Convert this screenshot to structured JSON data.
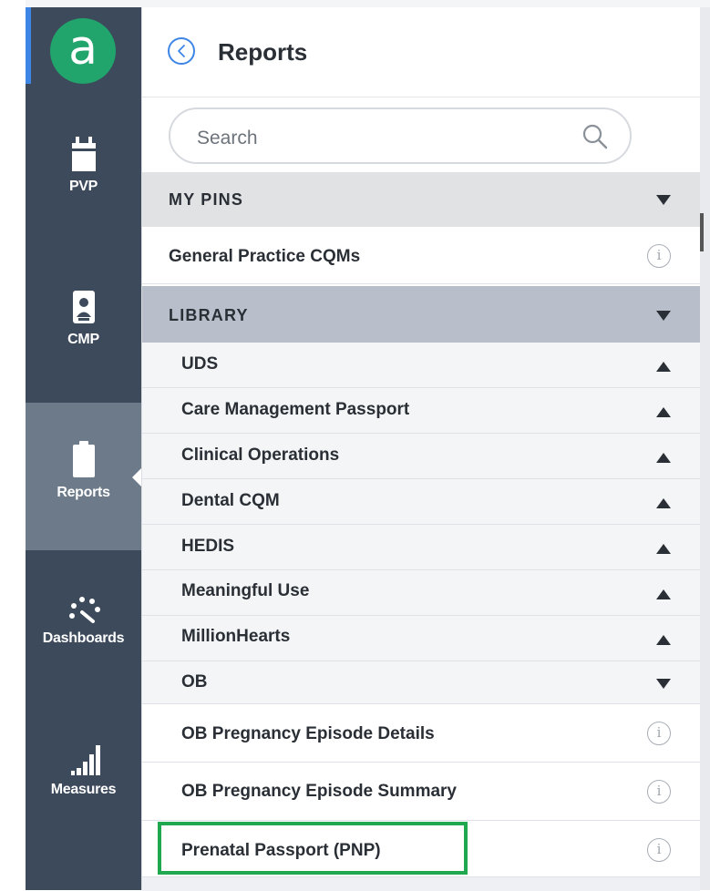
{
  "app": {
    "logo_letter": "a",
    "brand_color": "#21a56c",
    "accent_color": "#3d86e6"
  },
  "nav": {
    "items": [
      {
        "label": "PVP",
        "icon": "calendar-icon",
        "active": false
      },
      {
        "label": "CMP",
        "icon": "badge-icon",
        "active": false
      },
      {
        "label": "Reports",
        "icon": "clipboard-icon",
        "active": true
      },
      {
        "label": "Dashboards",
        "icon": "gauge-icon",
        "active": false
      },
      {
        "label": "Measures",
        "icon": "bar-signal-icon",
        "active": false
      }
    ]
  },
  "panel": {
    "title": "Reports",
    "search_placeholder": "Search",
    "my_pins": {
      "label": "MY PINS",
      "items": [
        {
          "label": "General Practice CQMs"
        }
      ]
    },
    "library": {
      "label": "LIBRARY",
      "categories": [
        {
          "label": "UDS",
          "expanded": false
        },
        {
          "label": "Care Management Passport",
          "expanded": false
        },
        {
          "label": "Clinical Operations",
          "expanded": false
        },
        {
          "label": "Dental CQM",
          "expanded": false
        },
        {
          "label": "HEDIS",
          "expanded": false
        },
        {
          "label": "Meaningful Use",
          "expanded": false
        },
        {
          "label": "MillionHearts",
          "expanded": false
        },
        {
          "label": "OB",
          "expanded": true
        }
      ],
      "ob_reports": [
        {
          "label": "OB Pregnancy Episode Details"
        },
        {
          "label": "OB Pregnancy Episode Summary"
        },
        {
          "label": "Prenatal Passport (PNP)",
          "highlighted": true
        }
      ]
    },
    "info_glyph": "i"
  }
}
